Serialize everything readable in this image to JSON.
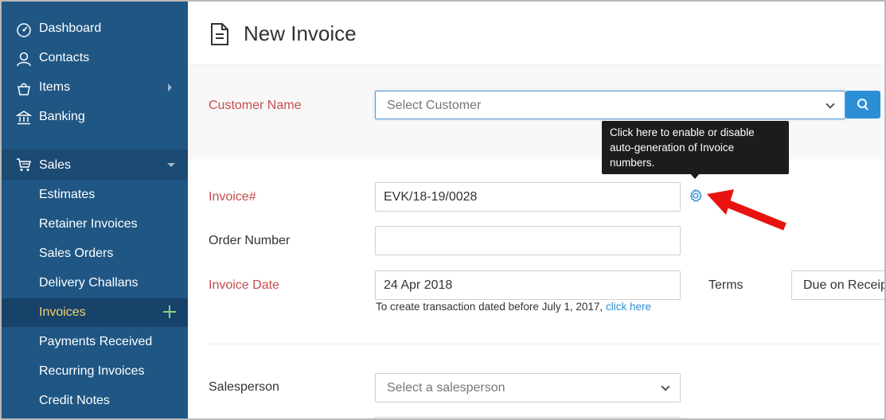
{
  "sidebar": {
    "top_items": [
      {
        "label": "Dashboard",
        "icon": "dashboard-icon"
      },
      {
        "label": "Contacts",
        "icon": "contacts-icon"
      },
      {
        "label": "Items",
        "icon": "items-icon"
      },
      {
        "label": "Banking",
        "icon": "banking-icon"
      }
    ],
    "sales": {
      "label": "Sales",
      "icon": "cart-icon",
      "items": [
        {
          "label": "Estimates"
        },
        {
          "label": "Retainer Invoices"
        },
        {
          "label": "Sales Orders"
        },
        {
          "label": "Delivery Challans"
        },
        {
          "label": "Invoices",
          "active": true
        },
        {
          "label": "Payments Received"
        },
        {
          "label": "Recurring Invoices"
        },
        {
          "label": "Credit Notes"
        }
      ]
    }
  },
  "header": {
    "title": "New Invoice",
    "icon": "document-icon"
  },
  "form": {
    "customer_name_label": "Customer Name",
    "customer_placeholder": "Select Customer",
    "invoice_number_label": "Invoice#",
    "invoice_number_value": "EVK/18-19/0028",
    "order_number_label": "Order Number",
    "order_number_value": "",
    "invoice_date_label": "Invoice Date",
    "invoice_date_value": "24 Apr 2018",
    "terms_label": "Terms",
    "terms_value": "Due on Receipt",
    "date_hint_text": "To create transaction dated before July 1, 2017,",
    "date_hint_link": "click here",
    "salesperson_label": "Salesperson",
    "salesperson_placeholder": "Select a salesperson"
  },
  "tooltip": {
    "text": "Click here to enable or disable auto-generation of Invoice numbers."
  },
  "colors": {
    "sidebar_bg": "#1f5684",
    "sidebar_active_bg": "#17426a",
    "active_text": "#f3d36a",
    "required_label": "#c74b4b",
    "accent_blue": "#2c8fd6",
    "arrow_red": "#e8130f"
  }
}
